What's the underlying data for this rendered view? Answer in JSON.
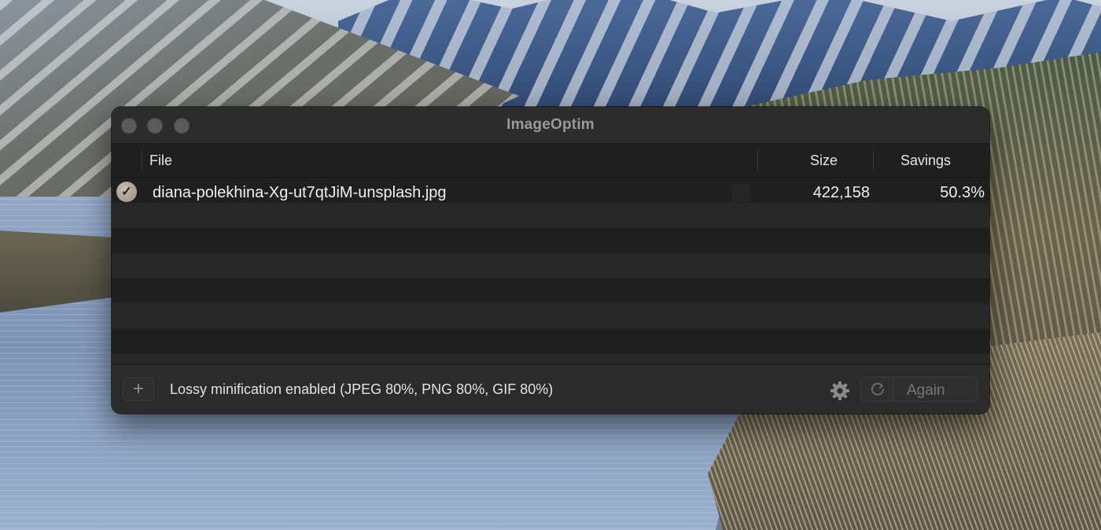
{
  "window": {
    "title": "ImageOptim"
  },
  "table": {
    "columns": {
      "file": "File",
      "size": "Size",
      "savings": "Savings"
    },
    "rows": [
      {
        "status_icon": "checkmark-icon",
        "status_glyph": "✓",
        "file": "diana-polekhina-Xg-ut7qtJiM-unsplash.jpg",
        "size": "422,158",
        "savings": "50.3%"
      }
    ]
  },
  "footer": {
    "add_label": "+",
    "status": "Lossy minification enabled (JPEG 80%, PNG 80%, GIF 80%)",
    "again_label": "Again"
  },
  "colors": {
    "window_bg": "#232323",
    "titlebar_bg": "#2d2c2c",
    "check_badge": "#a59c8e",
    "text": "#f0f0f0",
    "muted_text": "#767676"
  }
}
